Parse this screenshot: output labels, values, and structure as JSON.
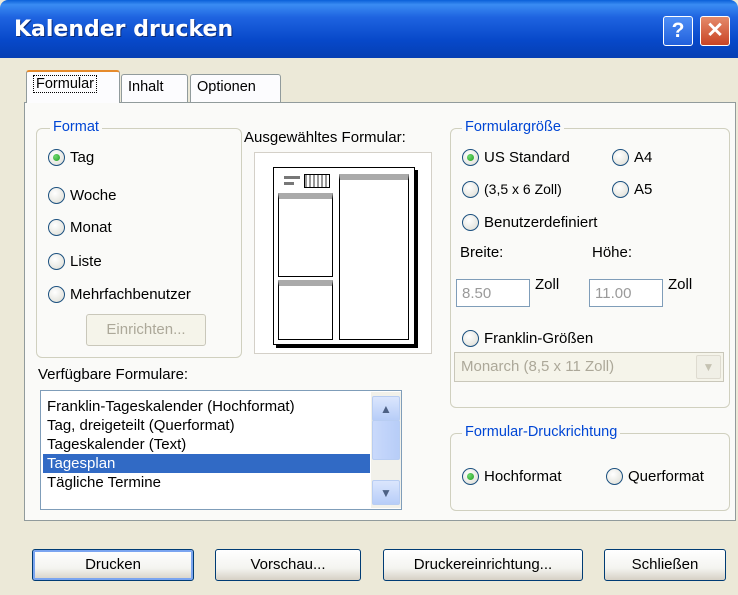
{
  "window": {
    "title": "Kalender drucken",
    "help_label": "?",
    "close_label": "✕"
  },
  "tabs": [
    {
      "label": "Formular",
      "active": true
    },
    {
      "label": "Inhalt",
      "active": false
    },
    {
      "label": "Optionen",
      "active": false
    }
  ],
  "format": {
    "legend": "Format",
    "options": [
      {
        "label": "Tag",
        "checked": true
      },
      {
        "label": "Woche",
        "checked": false
      },
      {
        "label": "Monat",
        "checked": false
      },
      {
        "label": "Liste",
        "checked": false
      },
      {
        "label": "Mehrfachbenutzer",
        "checked": false
      }
    ],
    "setup_button": "Einrichten..."
  },
  "preview": {
    "label": "Ausgewähltes Formular:"
  },
  "available": {
    "label": "Verfügbare Formulare:",
    "items": [
      {
        "label": "Franklin-Tageskalender (Hochformat)",
        "selected": false
      },
      {
        "label": "Tag, dreigeteilt (Querformat)",
        "selected": false
      },
      {
        "label": "Tageskalender (Text)",
        "selected": false
      },
      {
        "label": "Tagesplan",
        "selected": true
      },
      {
        "label": "Tägliche Termine",
        "selected": false
      }
    ]
  },
  "size": {
    "legend": "Formulargröße",
    "us_standard": "US Standard",
    "a4": "A4",
    "small": "(3,5 x 6 Zoll)",
    "a5": "A5",
    "custom": "Benutzerdefiniert",
    "width_label": "Breite:",
    "height_label": "Höhe:",
    "width_value": "8.50",
    "height_value": "11.00",
    "unit": "Zoll",
    "franklin": "Franklin-Größen",
    "franklin_combo": "Monarch   (8,5 x 11 Zoll)",
    "selected": "US Standard"
  },
  "orientation": {
    "legend": "Formular-Druckrichtung",
    "portrait": "Hochformat",
    "landscape": "Querformat",
    "selected": "Hochformat"
  },
  "buttons": {
    "print": "Drucken",
    "preview": "Vorschau...",
    "printer_setup": "Druckereinrichtung...",
    "close": "Schließen"
  },
  "colors": {
    "titlebar": "#0748c9",
    "group_legend": "#0046d5",
    "selection": "#316ac5",
    "dialog_bg": "#ece9d8"
  }
}
